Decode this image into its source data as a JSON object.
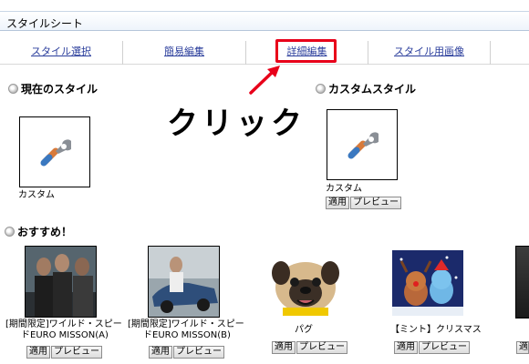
{
  "header": {
    "title": "スタイルシート"
  },
  "tabs": [
    {
      "label": "スタイル選択"
    },
    {
      "label": "簡易編集"
    },
    {
      "label": "詳細編集"
    },
    {
      "label": "スタイル用画像"
    }
  ],
  "annotation": {
    "click_text": "クリック",
    "highlight_color": "#e8001a"
  },
  "current_style": {
    "heading": "現在のスタイル",
    "name": "カスタム",
    "icon": "wrench-icon"
  },
  "custom_style": {
    "heading": "カスタムスタイル",
    "name": "カスタム",
    "icon": "wrench-icon",
    "apply_label": "適用",
    "preview_label": "プレビュー"
  },
  "recommended": {
    "heading": "おすすめ！",
    "items": [
      {
        "title_line1": "[期間限定]ワイルド・スピー",
        "title_line2": "ドEURO MISSON(A)",
        "apply_label": "適用",
        "preview_label": "プレビュー"
      },
      {
        "title_line1": "[期間限定]ワイルド・スピー",
        "title_line2": "ドEURO MISSON(B)",
        "apply_label": "適用",
        "preview_label": "プレビュー"
      },
      {
        "title_line1": "パグ",
        "title_line2": "",
        "apply_label": "適用",
        "preview_label": "プレビュー"
      },
      {
        "title_line1": "【ミント】クリスマス",
        "title_line2": "",
        "apply_label": "適用",
        "preview_label": "プレビュー"
      },
      {
        "title_line1": "",
        "title_line2": "",
        "apply_label": "適用",
        "preview_label": ""
      }
    ]
  }
}
